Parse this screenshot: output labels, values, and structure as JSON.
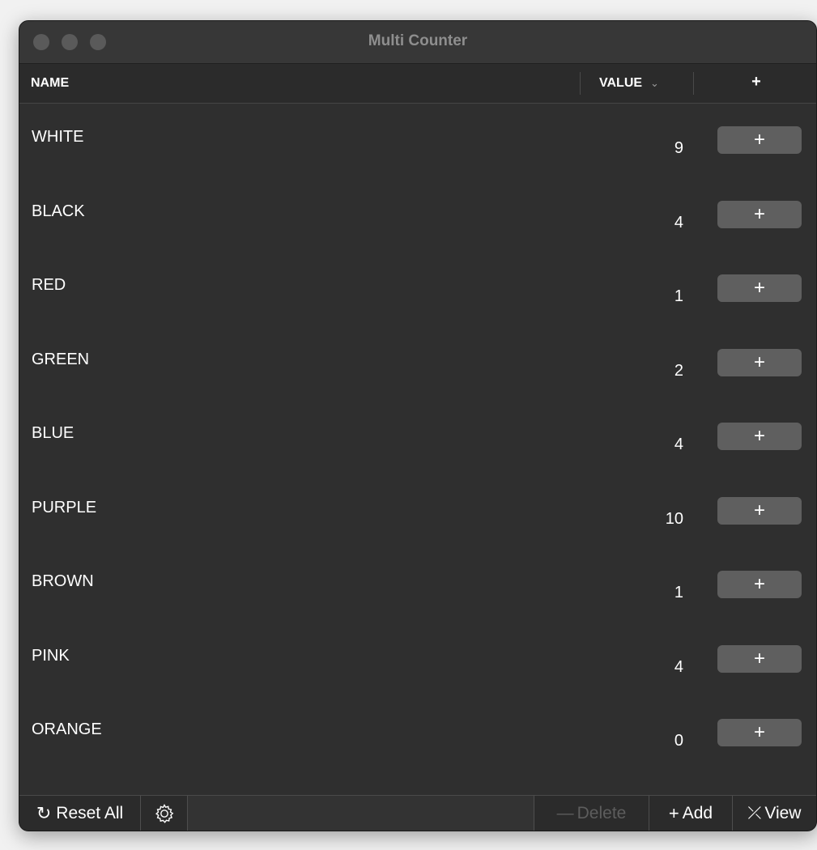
{
  "window": {
    "title": "Multi Counter"
  },
  "table": {
    "columns": {
      "name": "NAME",
      "value": "VALUE",
      "value_sort": "⌄",
      "action": "+"
    },
    "rows": [
      {
        "name": "WHITE",
        "value": "9",
        "button": "+"
      },
      {
        "name": "BLACK",
        "value": "4",
        "button": "+"
      },
      {
        "name": "RED",
        "value": "1",
        "button": "+"
      },
      {
        "name": "GREEN",
        "value": "2",
        "button": "+"
      },
      {
        "name": "BLUE",
        "value": "4",
        "button": "+"
      },
      {
        "name": "PURPLE",
        "value": "10",
        "button": "+"
      },
      {
        "name": "BROWN",
        "value": "1",
        "button": "+"
      },
      {
        "name": "PINK",
        "value": "4",
        "button": "+"
      },
      {
        "name": "ORANGE",
        "value": "0",
        "button": "+"
      }
    ]
  },
  "footer": {
    "reset_icon": "↻",
    "reset_label": "Reset All",
    "settings_icon": "gear-icon",
    "delete_icon": "—",
    "delete_label": "Delete",
    "add_icon": "+",
    "add_label": "Add",
    "view_icon": "⤫",
    "view_label": "View"
  },
  "colors": {
    "window_bg": "#2f2f2f",
    "titlebar_bg": "#373737",
    "row_button_bg": "#5f5f5f",
    "disabled_text": "#5d5d5d"
  }
}
